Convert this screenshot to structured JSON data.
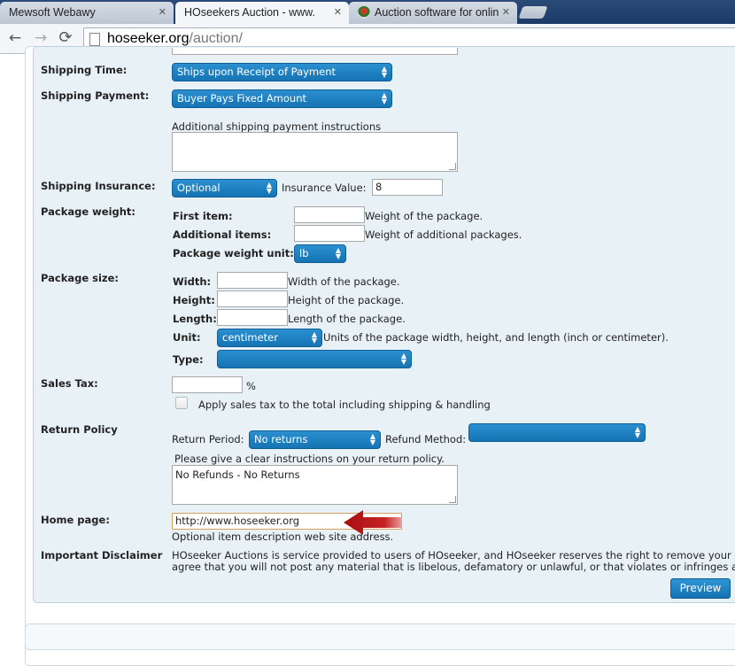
{
  "browser": {
    "tabs": [
      {
        "title": "Mewsoft Webawy",
        "state": "inactive"
      },
      {
        "title": "HOseekers Auction - www.",
        "state": "active"
      },
      {
        "title": "Auction software for onlin",
        "state": "inactive"
      }
    ],
    "url_host": "hoseeker.org",
    "url_path": "/auction/",
    "icons": {
      "back": "back-arrow-icon",
      "forward": "forward-arrow-icon",
      "reload": "reload-icon",
      "close": "close-icon"
    }
  },
  "form": {
    "shipping_time": {
      "label": "Shipping Time:",
      "value": "Ships upon Receipt of Payment"
    },
    "shipping_payment": {
      "label": "Shipping Payment:",
      "value": "Buyer Pays Fixed Amount",
      "instructions_label": "Additional shipping payment instructions",
      "instructions_value": ""
    },
    "shipping_insurance": {
      "label": "Shipping Insurance:",
      "value": "Optional",
      "insurance_value_label": "Insurance Value:",
      "insurance_value": "8"
    },
    "package_weight": {
      "label": "Package weight:",
      "first_item_label": "First item:",
      "first_item_hint": "Weight of the package.",
      "additional_label": "Additional items:",
      "additional_hint": "Weight of additional packages.",
      "unit_label": "Package weight unit:",
      "unit_value": "lb"
    },
    "package_size": {
      "label": "Package size:",
      "width_label": "Width:",
      "width_hint": "Width of the package.",
      "height_label": "Height:",
      "height_hint": "Height of the package.",
      "length_label": "Length:",
      "length_hint": "Length of the package.",
      "unit_label": "Unit:",
      "unit_value": "centimeter",
      "unit_hint": "Units of the package width, height, and length (inch or centimeter).",
      "type_label": "Type:",
      "type_value": ""
    },
    "sales_tax": {
      "label": "Sales Tax:",
      "value": "",
      "suffix": "%",
      "apply_label": "Apply sales tax to the total including shipping & handling"
    },
    "return_policy": {
      "label": "Return Policy",
      "period_label": "Return Period:",
      "period_value": "No returns",
      "refund_label": "Refund Method:",
      "refund_value": "",
      "instructions_label": "Please give a clear instructions on your return policy.",
      "instructions_value": "No Refunds - No Returns"
    },
    "home_page": {
      "label": "Home page:",
      "value": "http://www.hoseeker.org",
      "hint": "Optional item description web site address."
    },
    "disclaimer": {
      "label": "Important Disclaimer",
      "line1": "HOseeker Auctions is service provided to users of HOseeker, and HOseeker reserves the right to remove your",
      "line2": "agree that you will not post any material that is libelous, defamatory or unlawful, or that violates or infringes an"
    },
    "preview_label": "Preview"
  },
  "colors": {
    "select_blue": "#1a7fc2",
    "annotation_arrow": "#c0181a"
  }
}
